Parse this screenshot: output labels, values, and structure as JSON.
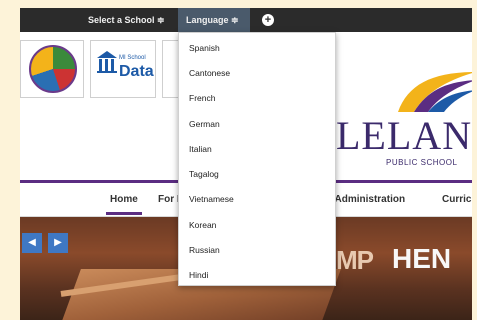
{
  "topbar": {
    "select_school": "Select a School ≑",
    "language": "Language ≑",
    "plus": "+"
  },
  "logos": {
    "mi_school_small": "MI School",
    "mi_school_data": "Data"
  },
  "brand": {
    "name": "LELAN",
    "sub": "PUBLIC SCHOOL"
  },
  "nav": {
    "home": "Home",
    "for": "For I",
    "board": "d & Administration",
    "curriculum": "Curricu"
  },
  "hero": {
    "prev": "◀",
    "next": "▶",
    "sign_mp": "MP",
    "sign_hen": "HEN"
  },
  "language_menu": {
    "items": [
      "Spanish",
      "Cantonese",
      "French",
      "German",
      "Italian",
      "Tagalog",
      "Vietnamese",
      "Korean",
      "Russian",
      "Hindi"
    ]
  },
  "colors": {
    "topbar": "#2b2b2b",
    "language_tab": "#4a5a6b",
    "brand_purple": "#5b2d82",
    "page_background": "#fdf3d9"
  }
}
